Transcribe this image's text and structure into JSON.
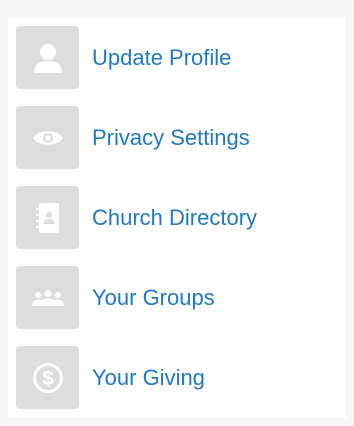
{
  "menu": {
    "items": [
      {
        "label": "Update Profile",
        "icon": "person-icon"
      },
      {
        "label": "Privacy Settings",
        "icon": "eye-icon"
      },
      {
        "label": "Church Directory",
        "icon": "address-book-icon"
      },
      {
        "label": "Your Groups",
        "icon": "group-icon"
      },
      {
        "label": "Your Giving",
        "icon": "dollar-coin-icon"
      }
    ]
  },
  "colors": {
    "tile_background": "#dddddd",
    "icon": "#ffffff",
    "link": "#1f7ac5",
    "page_background": "#f6f6f6"
  }
}
